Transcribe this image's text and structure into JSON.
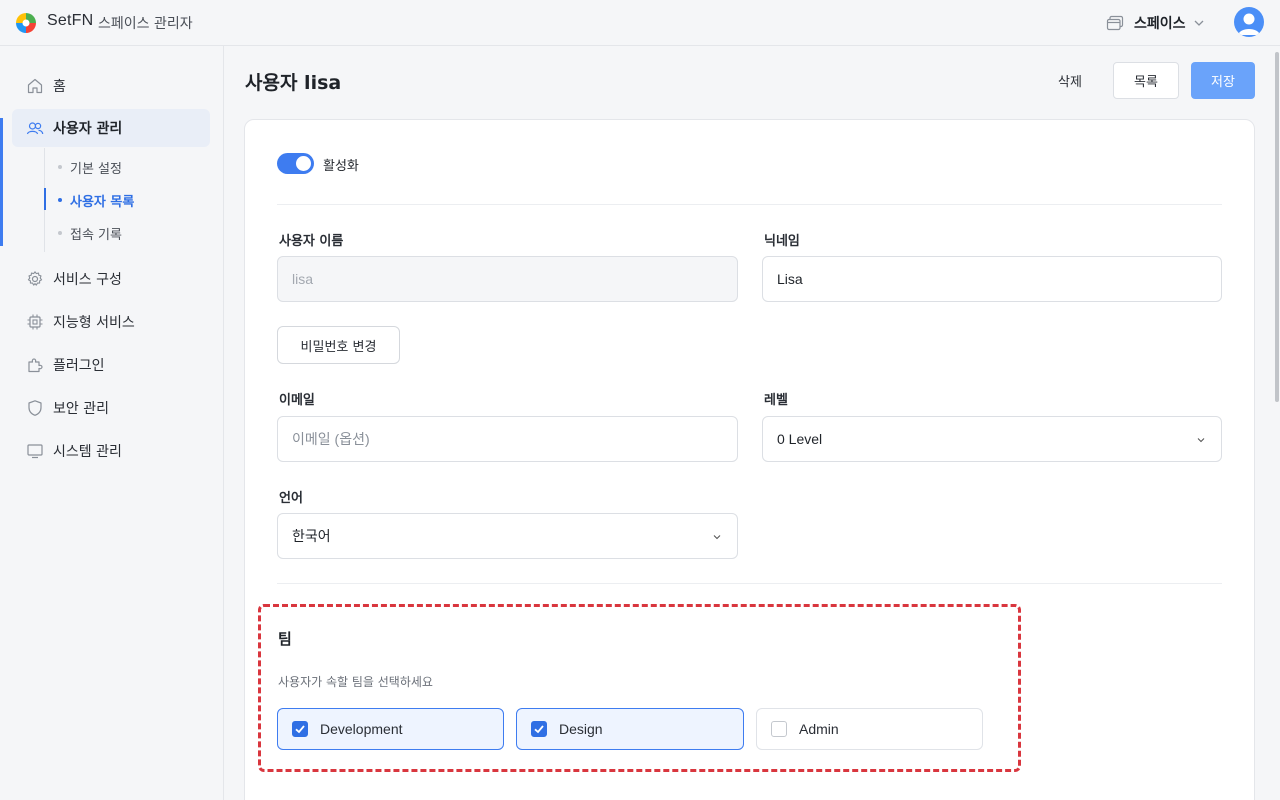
{
  "topbar": {
    "brand_name": "SetFN",
    "brand_sub": "스페이스 관리자",
    "space_label": "스페이스",
    "icons": {
      "logo": "setfn-logo",
      "space": "window-stack-icon",
      "chevron": "chevron-down-icon",
      "avatar": "user-avatar-icon"
    }
  },
  "sidebar": {
    "items": [
      {
        "label": "홈",
        "icon": "home-icon"
      },
      {
        "label": "사용자 관리",
        "icon": "users-icon",
        "active": true
      },
      {
        "label": "서비스 구성",
        "icon": "gear-icon"
      },
      {
        "label": "지능형 서비스",
        "icon": "chip-icon"
      },
      {
        "label": "플러그인",
        "icon": "puzzle-icon"
      },
      {
        "label": "보안 관리",
        "icon": "shield-icon"
      },
      {
        "label": "시스템 관리",
        "icon": "monitor-icon"
      }
    ],
    "sub_items": [
      {
        "label": "기본 설정"
      },
      {
        "label": "사용자 목록",
        "active": true
      },
      {
        "label": "접속 기록"
      }
    ]
  },
  "header": {
    "title": "사용자 lisa",
    "delete_label": "삭제",
    "list_label": "목록",
    "save_label": "저장"
  },
  "form": {
    "active_label": "활성화",
    "active": true,
    "username": {
      "label": "사용자 이름",
      "value": "lisa"
    },
    "nickname": {
      "label": "닉네임",
      "value": "Lisa"
    },
    "password_button": "비밀번호 변경",
    "email": {
      "label": "이메일",
      "placeholder": "이메일 (옵션)"
    },
    "level": {
      "label": "레벨",
      "value": "0 Level"
    },
    "language": {
      "label": "언어",
      "value": "한국어"
    }
  },
  "team": {
    "title": "팀",
    "description": "사용자가 속할 팀을 선택하세요",
    "options": [
      {
        "label": "Development",
        "checked": true
      },
      {
        "label": "Design",
        "checked": true
      },
      {
        "label": "Admin",
        "checked": false
      }
    ]
  },
  "colors": {
    "accent": "#3e7cf0",
    "save_button": "#6aa3fa",
    "highlight_border": "#d9363e"
  }
}
